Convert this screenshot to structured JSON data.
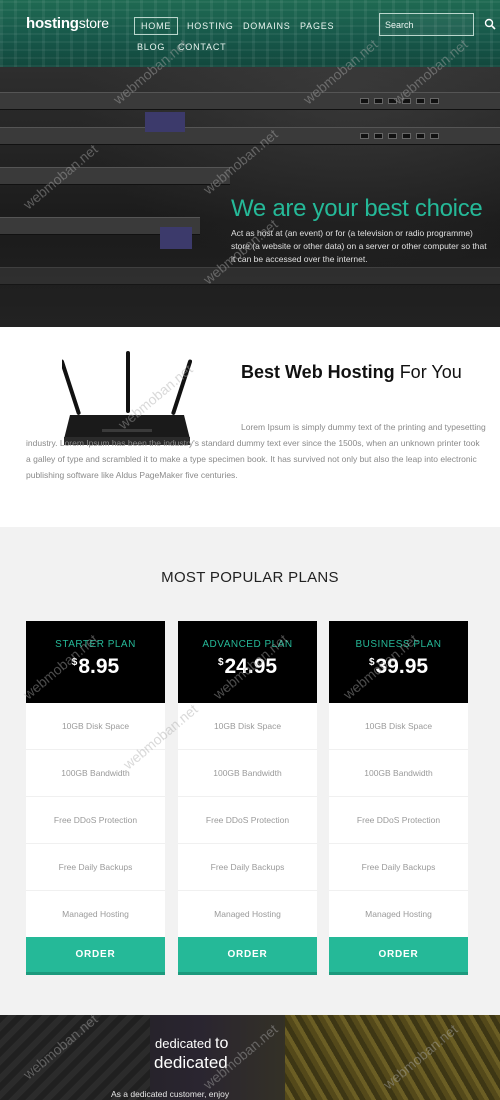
{
  "header": {
    "logo_bold": "hosting",
    "logo_light": "store",
    "nav": [
      "HOME",
      "HOSTING",
      "DOMAINS",
      "PAGES",
      "BLOG",
      "CONTACT"
    ],
    "search_placeholder": "Search",
    "accent": "#25b998"
  },
  "hero": {
    "title": "We are your best choice",
    "text": "Act as host at (an event) or for (a television or radio programme) store (a website or other data) on a server or other computer so that it can be accessed over the internet."
  },
  "about": {
    "title_bold": "Best Web Hosting",
    "title_rest": " For You",
    "text": "Lorem Ipsum is simply dummy text of the printing and typesetting industry. Lorem Ipsum has been the industry's standard dummy text ever since the 1500s, when an unknown printer took a galley of type and scrambled it to make a type specimen book. It has survived not only but also the leap into electronic publishing software like Aldus PageMaker five centuries."
  },
  "plans": {
    "title": "MOST POPULAR PLANS",
    "currency": "$",
    "items": [
      {
        "name": "STARTER PLAN",
        "price": "8.95",
        "features": [
          "10GB Disk Space",
          "100GB Bandwidth",
          "Free DDoS Protection",
          "Free Daily Backups",
          "Managed Hosting"
        ],
        "button": "ORDER"
      },
      {
        "name": "ADVANCED PLAN",
        "price": "24.95",
        "features": [
          "10GB Disk Space",
          "100GB Bandwidth",
          "Free DDoS Protection",
          "Free Daily Backups",
          "Managed Hosting"
        ],
        "button": "ORDER"
      },
      {
        "name": "BUSINESS PLAN",
        "price": "39.95",
        "features": [
          "10GB Disk Space",
          "100GB Bandwidth",
          "Free DDoS Protection",
          "Free Daily Backups",
          "Managed Hosting"
        ],
        "button": "ORDER"
      }
    ]
  },
  "dedicated": {
    "line1": "dedicated",
    "line1_to": "to",
    "line2": "dedicated",
    "text": "As a dedicated customer, enjoy"
  },
  "watermark": "webmoban.net"
}
